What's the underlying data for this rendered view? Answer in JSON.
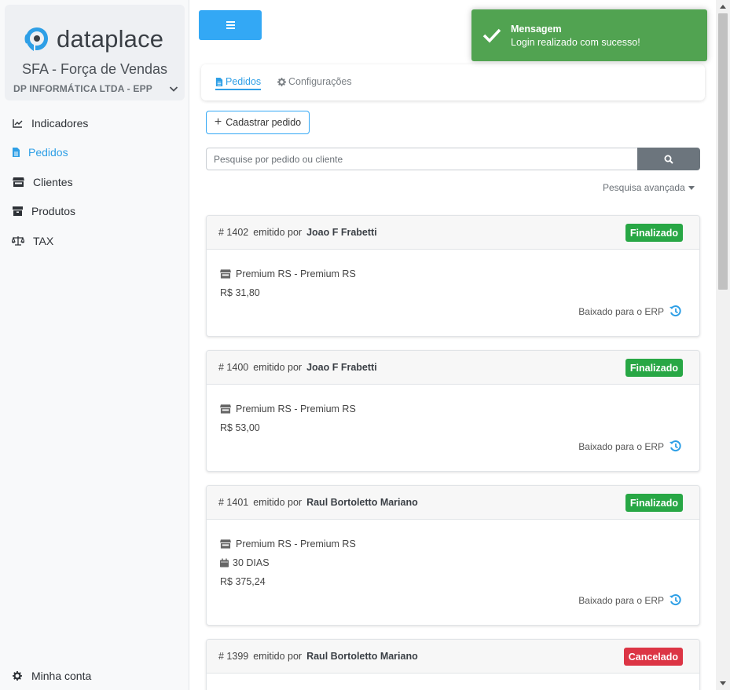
{
  "brand": {
    "logo_text": "dataplace",
    "subtitle": "SFA - Força de Vendas",
    "company": "DP INFORMÁTICA LTDA - EPP",
    "logo_color": "#2e9fe6"
  },
  "sidebar": {
    "items": [
      {
        "label": "Indicadores",
        "icon": "chart-line-icon"
      },
      {
        "label": "Pedidos",
        "icon": "file-icon",
        "active": true
      },
      {
        "label": "Clientes",
        "icon": "store-icon"
      },
      {
        "label": "Produtos",
        "icon": "box-icon"
      },
      {
        "label": "TAX",
        "icon": "balance-scale-icon"
      }
    ],
    "account_label": "Minha conta"
  },
  "tabs": {
    "pedidos": "Pedidos",
    "config": "Configurações"
  },
  "actions": {
    "cadastrar_label": "Cadastrar pedido"
  },
  "search": {
    "placeholder": "Pesquise por pedido ou cliente",
    "advanced_label": "Pesquisa avançada"
  },
  "orders": [
    {
      "number": "# 1402",
      "emitted_by_label": "emitido por",
      "author": "Joao F Frabetti",
      "status": "Finalizado",
      "store": "Premium RS - Premium RS",
      "value": "R$ 31,80",
      "erp": "Baixado para o ERP"
    },
    {
      "number": "# 1400",
      "emitted_by_label": "emitido por",
      "author": "Joao F Frabetti",
      "status": "Finalizado",
      "store": "Premium RS - Premium RS",
      "value": "R$ 53,00",
      "erp": "Baixado para o ERP"
    },
    {
      "number": "# 1401",
      "emitted_by_label": "emitido por",
      "author": "Raul Bortoletto Mariano",
      "status": "Finalizado",
      "store": "Premium RS - Premium RS",
      "term": "30 DIAS",
      "value": "R$ 375,24",
      "erp": "Baixado para o ERP"
    },
    {
      "number": "# 1399",
      "emitted_by_label": "emitido por",
      "author": "Raul Bortoletto Mariano",
      "status": "Cancelado"
    }
  ],
  "toast": {
    "title": "Mensagem",
    "message": "Login realizado com sucesso!",
    "color": "#51a351"
  },
  "colors": {
    "accent": "#2e9fe6",
    "success": "#28a745",
    "danger": "#dc3545"
  }
}
